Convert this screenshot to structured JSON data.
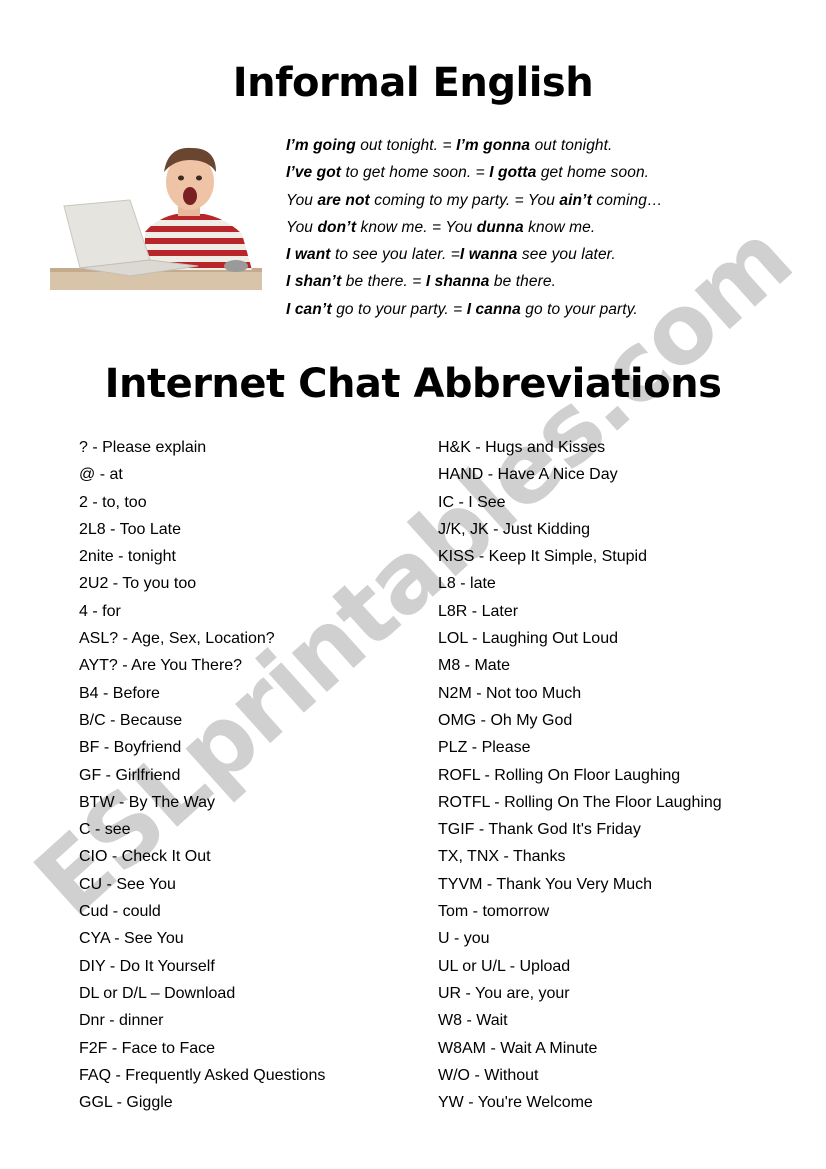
{
  "document": {
    "title": "Informal English",
    "section_title": "Internet Chat Abbreviations",
    "watermark": "ESLprintables.com",
    "image_alt": "boy-with-laptop-photo"
  },
  "informal_english": [
    {
      "parts": [
        {
          "t": "I’m going",
          "b": true
        },
        {
          "t": " out tonight. = ",
          "b": false
        },
        {
          "t": "I’m gonna",
          "b": true
        },
        {
          "t": " out tonight.",
          "b": false
        }
      ]
    },
    {
      "parts": [
        {
          "t": "I’ve got",
          "b": true
        },
        {
          "t": " to get home soon. = ",
          "b": false
        },
        {
          "t": "I gotta",
          "b": true
        },
        {
          "t": " get home soon.",
          "b": false
        }
      ]
    },
    {
      "parts": [
        {
          "t": "You ",
          "b": false
        },
        {
          "t": "are not",
          "b": true
        },
        {
          "t": " coming to my party. = You ",
          "b": false
        },
        {
          "t": "ain’t",
          "b": true
        },
        {
          "t": " coming…",
          "b": false
        }
      ]
    },
    {
      "parts": [
        {
          "t": "You ",
          "b": false
        },
        {
          "t": "don’t",
          "b": true
        },
        {
          "t": " know me. = You ",
          "b": false
        },
        {
          "t": "dunna",
          "b": true
        },
        {
          "t": " know me.",
          "b": false
        }
      ]
    },
    {
      "parts": [
        {
          "t": "I want",
          "b": true
        },
        {
          "t": " to see you later. =",
          "b": false
        },
        {
          "t": "I wanna",
          "b": true
        },
        {
          "t": " see you later.",
          "b": false
        }
      ]
    },
    {
      "parts": [
        {
          "t": "I shan’t",
          "b": true
        },
        {
          "t": " be there. = ",
          "b": false
        },
        {
          "t": "I shanna",
          "b": true
        },
        {
          "t": " be there.",
          "b": false
        }
      ]
    },
    {
      "parts": [
        {
          "t": "I can’t",
          "b": true
        },
        {
          "t": " go to your party. = ",
          "b": false
        },
        {
          "t": "I canna",
          "b": true
        },
        {
          "t": " go to your party.",
          "b": false
        }
      ]
    }
  ],
  "abbreviations": {
    "left": [
      "? - Please explain",
      "@ - at",
      "2 - to, too",
      "2L8 - Too Late",
      "2nite - tonight",
      "2U2 - To you too",
      "4 - for",
      "ASL? - Age, Sex, Location?",
      "AYT? - Are You There?",
      "B4 - Before",
      "B/C - Because",
      "BF - Boyfriend",
      "GF - Girlfriend",
      "BTW - By The Way",
      "C - see",
      "CIO - Check It Out",
      "CU - See You",
      "Cud - could",
      "CYA - See You",
      "DIY - Do It Yourself",
      "DL or D/L – Download",
      "Dnr - dinner",
      "F2F - Face to Face",
      "FAQ - Frequently Asked Questions",
      "GGL - Giggle"
    ],
    "right": [
      "H&K - Hugs and Kisses",
      "HAND - Have A Nice Day",
      "IC - I See",
      "J/K, JK - Just Kidding",
      "KISS - Keep It Simple, Stupid",
      "L8 - late",
      "L8R - Later",
      "LOL - Laughing Out Loud",
      "M8 - Mate",
      "N2M - Not too Much",
      "OMG - Oh My God",
      "PLZ - Please",
      "ROFL - Rolling On Floor Laughing",
      "ROTFL - Rolling On The Floor Laughing",
      "TGIF - Thank God It's Friday",
      "TX, TNX - Thanks",
      "TYVM - Thank You Very Much",
      "Tom - tomorrow",
      "U - you",
      "UL or U/L - Upload",
      "UR - You are, your",
      "W8 - Wait",
      "W8AM - Wait A Minute",
      "W/O - Without",
      "YW - You're Welcome"
    ]
  },
  "colors": {
    "text": "#000000",
    "background": "#ffffff",
    "watermark": "#c8c8c8",
    "shirt_red": "#b8262c",
    "shirt_white": "#f2ece6",
    "laptop": "#e4e2dc",
    "desk": "#cdb79a"
  }
}
